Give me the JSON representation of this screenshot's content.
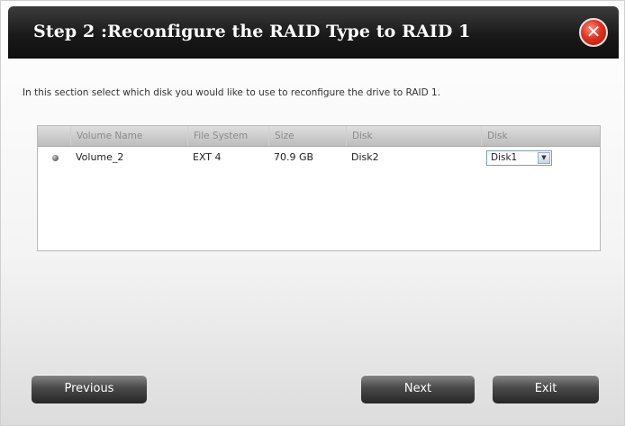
{
  "dialog": {
    "title": "Step 2 :Reconfigure the RAID Type to RAID 1",
    "close_icon": "close-x-icon"
  },
  "instructions": "In this section select which disk you would like to use to reconfigure the drive to RAID 1.",
  "table": {
    "headers": [
      "",
      "Volume Name",
      "File System",
      "Size",
      "Disk",
      "Disk"
    ],
    "rows": [
      {
        "selected": true,
        "volume_name": "Volume_2",
        "file_system": "EXT 4",
        "size": "70.9 GB",
        "disk": "Disk2",
        "disk_select": "Disk1"
      }
    ]
  },
  "buttons": {
    "previous": "Previous",
    "next": "Next",
    "exit": "Exit"
  },
  "colors": {
    "title_bar": "#1a1a1a",
    "close_button": "#e0321e",
    "button": "#4a4a4a"
  }
}
